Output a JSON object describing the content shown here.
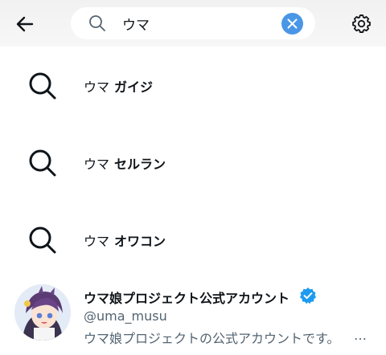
{
  "search": {
    "value": "ウマ",
    "placeholder": ""
  },
  "icons": {
    "back": "arrow-left-icon",
    "search": "search-icon",
    "clear": "close-icon",
    "settings": "gear-icon",
    "verified": "verified-badge-icon"
  },
  "suggestions": [
    {
      "query": "ウマ",
      "completion": "ガイジ"
    },
    {
      "query": "ウマ",
      "completion": "セルラン"
    },
    {
      "query": "ウマ",
      "completion": "オワコン"
    }
  ],
  "account": {
    "name": "ウマ娘プロジェクト公式アカウント",
    "handle": "@uma_musu",
    "bio": "ウマ娘プロジェクトの公式アカウントです。",
    "bio_overflow": "…"
  },
  "colors": {
    "accent": "#4a96e6",
    "header_bg": "#f3f3f3",
    "secondary_text": "#536471"
  }
}
